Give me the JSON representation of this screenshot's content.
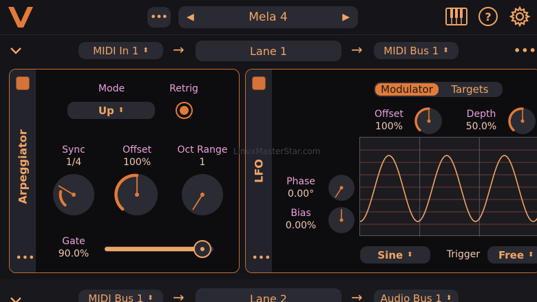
{
  "header": {
    "preset_name": "Mela 4",
    "more_label": "•••",
    "prev_label": "◀",
    "next_label": "▶",
    "help_label": "?"
  },
  "lane1": {
    "input": "MIDI In 1",
    "name": "Lane 1",
    "output": "MIDI Bus 1",
    "more_label": "•••"
  },
  "lane2": {
    "input": "MIDI Bus 1",
    "name": "Lane 2",
    "output": "Audio Bus 1"
  },
  "arpeggiator": {
    "title": "Arpeggiator",
    "mode_label": "Mode",
    "mode_value": "Up",
    "retrig_label": "Retrig",
    "retrig_on": true,
    "sync_label": "Sync",
    "sync_value": "1/4",
    "offset_label": "Offset",
    "offset_value": "100%",
    "oct_range_label": "Oct Range",
    "oct_range_value": "1",
    "gate_label": "Gate",
    "gate_value": "90.0%",
    "gate_level": 0.9,
    "more_label": "•••"
  },
  "lfo": {
    "title": "LFO",
    "tabs": [
      "Modulator",
      "Targets"
    ],
    "active_tab": "Modulator",
    "offset_label": "Offset",
    "offset_value": "100%",
    "depth_label": "Depth",
    "depth_value": "50.0%",
    "phase_label": "Phase",
    "phase_value": "0.00°",
    "bias_label": "Bias",
    "bias_value": "0.00%",
    "waveform": "Sine",
    "trigger_label": "Trigger",
    "trigger_value": "Free",
    "more_label": "•••"
  },
  "watermark": "LinuxMasterStar.com",
  "colors": {
    "accent": "#e27b38",
    "label_pink": "#e9a0d8",
    "background": "#141419"
  }
}
